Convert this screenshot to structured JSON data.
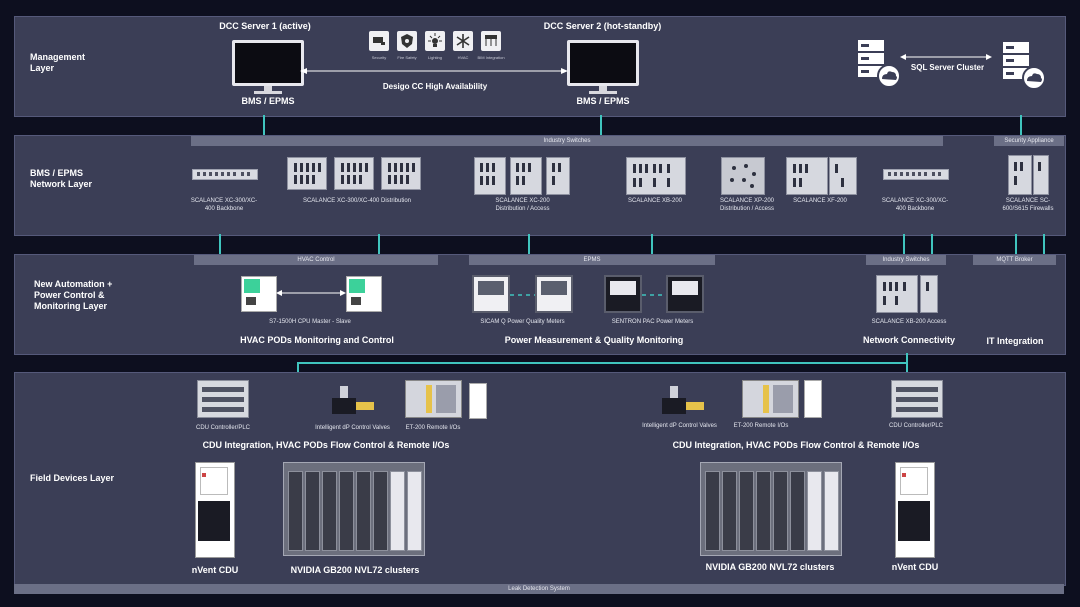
{
  "layers": {
    "management": "Management Layer",
    "network": "BMS / EPMS Network Layer",
    "automation": "New Automation + Power Control & Monitoring Layer",
    "field": "Field Devices Layer"
  },
  "management": {
    "server1_title": "DCC Server 1 (active)",
    "server2_title": "DCC Server 2 (hot-standby)",
    "server1_label": "BMS / EPMS",
    "server2_label": "BMS / EPMS",
    "ha_label": "Desigo CC High Availability",
    "sql_label": "SQL Server Cluster",
    "icons": [
      {
        "name": "security-icon",
        "label": "Security"
      },
      {
        "name": "fire-safety-icon",
        "label": "Fire Safety"
      },
      {
        "name": "lighting-icon",
        "label": "Lighting"
      },
      {
        "name": "hvac-icon",
        "label": "HVAC"
      },
      {
        "name": "bim-integration-icon",
        "label": "BIM Integration"
      }
    ]
  },
  "network": {
    "industry_switches": "Industry Switches",
    "security_appliance": "Security Appliance",
    "devices": [
      {
        "label": "SCALANCE XC-300/XC-400 Backbone"
      },
      {
        "label": "SCALANCE XC-300/XC-400 Distribution"
      },
      {
        "label": "SCALANCE XC-200 Distribution / Access"
      },
      {
        "label": "SCALANCE XB-200"
      },
      {
        "label": "SCALANCE XP-200 Distribution / Access"
      },
      {
        "label": "SCALANCE XF-200"
      },
      {
        "label": "SCALANCE XC-300/XC-400 Backbone"
      },
      {
        "label": "SCALANCE SC-600/S615 Firewalls"
      }
    ]
  },
  "automation": {
    "hvac_control": "HVAC Control",
    "epms": "EPMS",
    "industry_switches": "Industry Switches",
    "mqtt_broker": "MQTT Broker",
    "cpu_label": "S7-1500H CPU Master - Slave",
    "sicam_label": "SICAM Q Power Quality Meters",
    "sentron_label": "SENTRON PAC Power Meters",
    "xb200_label": "SCALANCE XB-200 Access",
    "hvac_header": "HVAC PODs Monitoring and Control",
    "power_header": "Power Measurement & Quality Monitoring",
    "network_header": "Network Connectivity",
    "it_header": "IT Integration"
  },
  "field": {
    "left": {
      "cdu_ctrl": "CDU Controller/PLC",
      "valves": "Intelligent dP Control Valves",
      "et200": "ET-200 Remote I/Os",
      "header": "CDU Integration, HVAC PODs Flow Control & Remote I/Os",
      "nvent": "nVent CDU",
      "nvidia": "NVIDIA GB200 NVL72 clusters"
    },
    "right": {
      "valves": "Intelligent dP Control Valves",
      "et200": "ET-200 Remote I/Os",
      "cdu_ctrl": "CDU Controller/PLC",
      "header": "CDU Integration, HVAC PODs Flow Control & Remote I/Os",
      "nvidia": "NVIDIA GB200 NVL72 clusters",
      "nvent": "nVent CDU"
    },
    "leak": "Leak Detection System"
  },
  "colors": {
    "connector": "#40c4be",
    "panel": "#3b3e56",
    "bar": "#6b6f86",
    "background": "#0d0f1f"
  }
}
